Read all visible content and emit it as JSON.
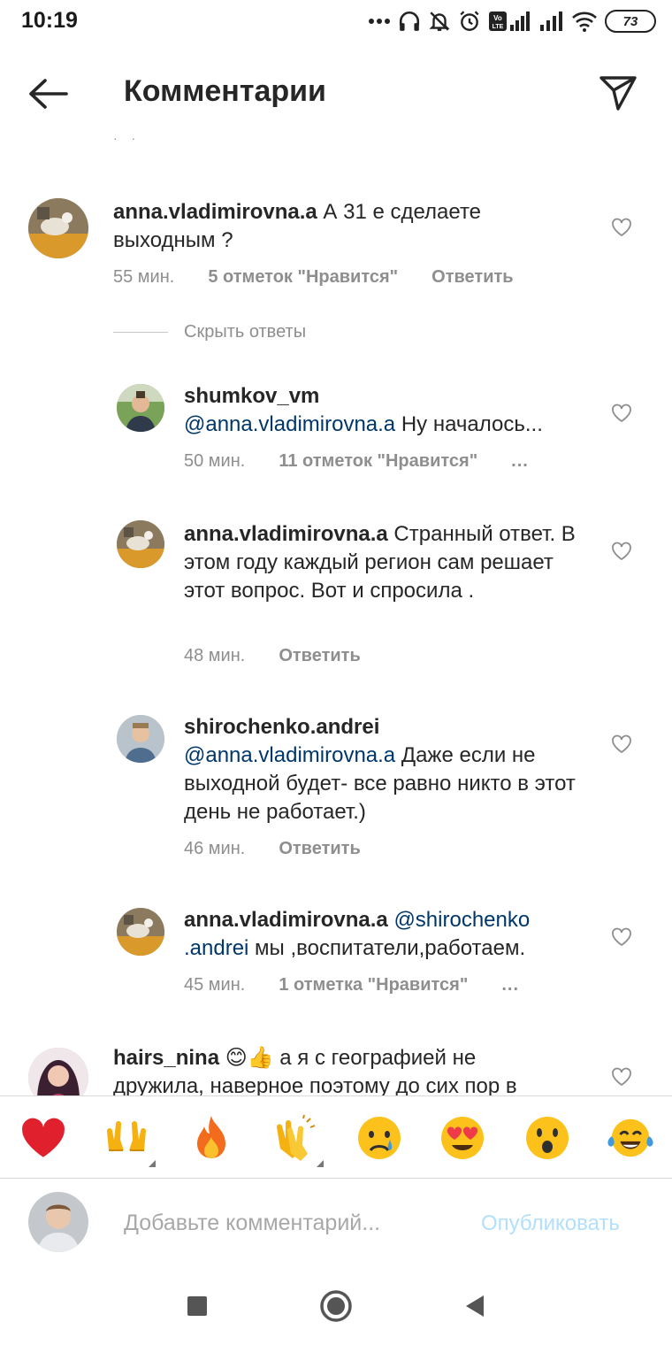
{
  "status_bar": {
    "time": "10:19",
    "battery": "73"
  },
  "header": {
    "title": "Комментарии"
  },
  "comments": [
    {
      "username": "anna.vladimirovna.a",
      "text": " А 31 е сделаете выходным ?",
      "time": "55 мин.",
      "likes": "5 отметок \"Нравится\"",
      "reply": "Ответить"
    },
    {
      "username": "shumkov_vm",
      "mention": "@anna.vladimirovna.a",
      "text": " Ну началось...",
      "time": "50 мин.",
      "likes": "11 отметок \"Нравится\"",
      "more": "..."
    },
    {
      "username": "anna.vladimirovna.a",
      "text": " Странный ответ. В этом году каждый регион сам решает этот вопрос. Вот и спросила .",
      "time": "48 мин.",
      "reply": "Ответить"
    },
    {
      "username": "shirochenko.andrei",
      "mention": "@anna.vladimirovna.a",
      "text": " Даже если не выходной будет- все равно никто в этот день не работает.)",
      "time": "46 мин.",
      "reply": "Ответить"
    },
    {
      "username": "anna.vladimirovna.a",
      "mention_line1": "@shirochenko",
      "mention_line2": ".andrei",
      "text": " мы ,воспитатели,работаем.",
      "time": "45 мин.",
      "likes": "1 отметка \"Нравится\"",
      "more": "..."
    },
    {
      "username": "hairs_nina",
      "emojis": "😊👍",
      "text": " а я с географией не дружила, наверное поэтому до сих пор в"
    }
  ],
  "replies_toggle": "Скрыть ответы",
  "emoji_bar": [
    "red-heart",
    "raising-hands",
    "fire",
    "clapping-hands",
    "crying-face",
    "heart-eyes",
    "astonished-face",
    "tears-of-joy"
  ],
  "composer": {
    "placeholder": "Добавьте комментарий...",
    "publish": "Опубликовать"
  },
  "colors": {
    "mention": "#00376b",
    "meta": "#8e8e8e",
    "publish_disabled": "#b2dffc",
    "heart": "#ed2c38"
  }
}
